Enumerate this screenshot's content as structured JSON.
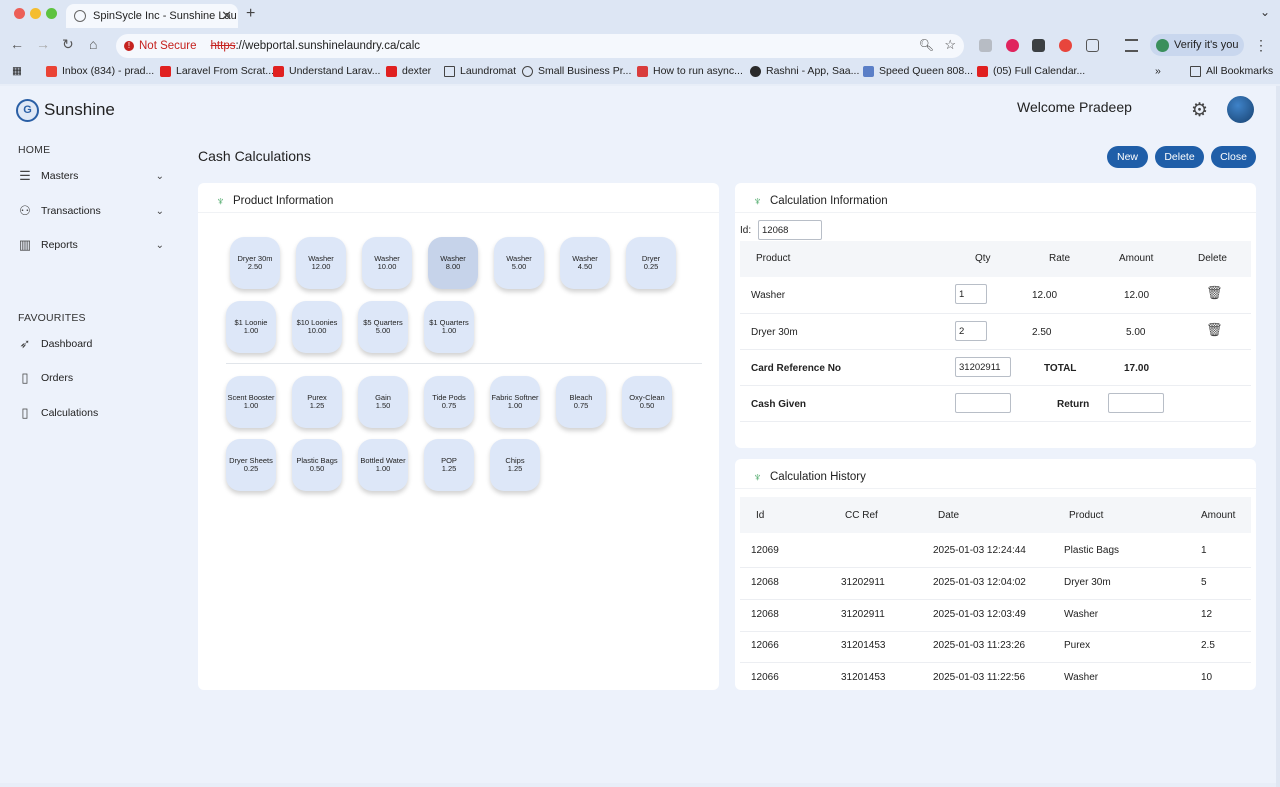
{
  "browser": {
    "tab_title": "SpinSycle Inc - Sunshine Lau",
    "url_scheme": "https",
    "url_rest": "://webportal.sunshinelaundry.ca/calc",
    "not_secure_label": "Not Secure",
    "verify_label": "Verify it's you",
    "bookmarks": [
      "Inbox (834) - prad...",
      "Laravel From Scrat...",
      "Understand Larav...",
      "dexter",
      "Laundromat",
      "Small Business Pr...",
      "How to run async...",
      "Rashni - App, Saa...",
      "Speed Queen 808...",
      "(05) Full Calendar..."
    ],
    "all_bookmarks_label": "All Bookmarks"
  },
  "header": {
    "logo_letter": "G",
    "brand": "Sunshine",
    "welcome": "Welcome Pradeep"
  },
  "sidebar": {
    "home_label": "HOME",
    "items": [
      {
        "label": "Masters",
        "icon": "masters-icon"
      },
      {
        "label": "Transactions",
        "icon": "transactions-icon"
      },
      {
        "label": "Reports",
        "icon": "reports-icon"
      }
    ],
    "favourites_label": "FAVOURITES",
    "favourites": [
      {
        "label": "Dashboard",
        "icon": "rocket-icon"
      },
      {
        "label": "Orders",
        "icon": "document-icon"
      },
      {
        "label": "Calculations",
        "icon": "document-icon"
      }
    ]
  },
  "page": {
    "title": "Cash Calculations",
    "buttons": {
      "new": "New",
      "delete": "Delete",
      "close": "Close"
    }
  },
  "product_info": {
    "title": "Product Information",
    "machines": [
      {
        "name": "Dryer 30m",
        "price": "2.50"
      },
      {
        "name": "Washer",
        "price": "12.00"
      },
      {
        "name": "Washer",
        "price": "10.00"
      },
      {
        "name": "Washer",
        "price": "8.00"
      },
      {
        "name": "Washer",
        "price": "5.00"
      },
      {
        "name": "Washer",
        "price": "4.50"
      },
      {
        "name": "Dryer",
        "price": "0.25"
      },
      {
        "name": "$1 Loonie",
        "price": "1.00"
      },
      {
        "name": "$10 Loonies",
        "price": "10.00"
      },
      {
        "name": "$5 Quarters",
        "price": "5.00"
      },
      {
        "name": "$1 Quarters",
        "price": "1.00"
      }
    ],
    "supplies": [
      {
        "name": "Scent Booster",
        "price": "1.00"
      },
      {
        "name": "Purex",
        "price": "1.25"
      },
      {
        "name": "Gain",
        "price": "1.50"
      },
      {
        "name": "Tide Pods",
        "price": "0.75"
      },
      {
        "name": "Fabric Softner",
        "price": "1.00"
      },
      {
        "name": "Bleach",
        "price": "0.75"
      },
      {
        "name": "Oxy-Clean",
        "price": "0.50"
      },
      {
        "name": "Dryer Sheets",
        "price": "0.25"
      },
      {
        "name": "Plastic Bags",
        "price": "0.50"
      },
      {
        "name": "Bottled Water",
        "price": "1.00"
      },
      {
        "name": "POP",
        "price": "1.25"
      },
      {
        "name": "Chips",
        "price": "1.25"
      }
    ]
  },
  "calc_info": {
    "title": "Calculation Information",
    "id_label": "Id:",
    "id_value": "12068",
    "columns": {
      "product": "Product",
      "qty": "Qty",
      "rate": "Rate",
      "amount": "Amount",
      "delete": "Delete"
    },
    "rows": [
      {
        "product": "Washer",
        "qty": "1",
        "rate": "12.00",
        "amount": "12.00"
      },
      {
        "product": "Dryer 30m",
        "qty": "2",
        "rate": "2.50",
        "amount": "5.00"
      }
    ],
    "card_ref_label": "Card Reference No",
    "card_ref_value": "31202911",
    "total_label": "TOTAL",
    "total_value": "17.00",
    "cash_given_label": "Cash Given",
    "cash_given_value": "",
    "return_label": "Return",
    "return_value": ""
  },
  "history": {
    "title": "Calculation History",
    "columns": {
      "id": "Id",
      "ccref": "CC Ref",
      "date": "Date",
      "product": "Product",
      "amount": "Amount"
    },
    "rows": [
      {
        "id": "12069",
        "ccref": "",
        "date": "2025-01-03 12:24:44",
        "product": "Plastic Bags",
        "amount": "1"
      },
      {
        "id": "12068",
        "ccref": "31202911",
        "date": "2025-01-03 12:04:02",
        "product": "Dryer 30m",
        "amount": "5"
      },
      {
        "id": "12068",
        "ccref": "31202911",
        "date": "2025-01-03 12:03:49",
        "product": "Washer",
        "amount": "12"
      },
      {
        "id": "12066",
        "ccref": "31201453",
        "date": "2025-01-03 11:23:26",
        "product": "Purex",
        "amount": "2.5"
      },
      {
        "id": "12066",
        "ccref": "31201453",
        "date": "2025-01-03 11:22:56",
        "product": "Washer",
        "amount": "10"
      }
    ]
  }
}
